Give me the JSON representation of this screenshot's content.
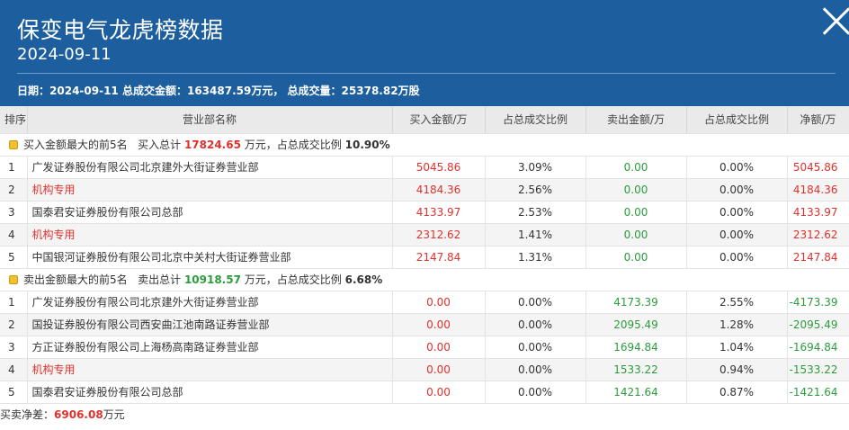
{
  "header": {
    "title": "保变电气龙虎榜数据",
    "date": "2024-09-11",
    "summary": {
      "date_label": "日期：",
      "date_value": "2024-09-11",
      "amount_label": "总成交金额：",
      "amount_value": "163487.59万元，",
      "volume_label": "总成交量：",
      "volume_value": "25378.82万股"
    }
  },
  "table": {
    "columns": [
      "排序",
      "营业部名称",
      "买入金额/万",
      "占总成交比例",
      "卖出金额/万",
      "占总成交比例",
      "净额/万"
    ]
  },
  "buy_group": {
    "label": "买入金额最大的前5名",
    "total_label": "买入总计",
    "total_value": "17824.65",
    "unit": "万元，",
    "ratio_label": "占总成交比例",
    "ratio_value": "10.90%",
    "rows": [
      {
        "rank": "1",
        "name": "广发证券股份有限公司北京建外大街证券营业部",
        "institution": false,
        "buy": "5045.86",
        "buy_pct": "3.09%",
        "sell": "0.00",
        "sell_pct": "0.00%",
        "net": "5045.86",
        "net_sign": "pos"
      },
      {
        "rank": "2",
        "name": "机构专用",
        "institution": true,
        "buy": "4184.36",
        "buy_pct": "2.56%",
        "sell": "0.00",
        "sell_pct": "0.00%",
        "net": "4184.36",
        "net_sign": "pos"
      },
      {
        "rank": "3",
        "name": "国泰君安证券股份有限公司总部",
        "institution": false,
        "buy": "4133.97",
        "buy_pct": "2.53%",
        "sell": "0.00",
        "sell_pct": "0.00%",
        "net": "4133.97",
        "net_sign": "pos"
      },
      {
        "rank": "4",
        "name": "机构专用",
        "institution": true,
        "buy": "2312.62",
        "buy_pct": "1.41%",
        "sell": "0.00",
        "sell_pct": "0.00%",
        "net": "2312.62",
        "net_sign": "pos"
      },
      {
        "rank": "5",
        "name": "中国银河证券股份有限公司北京中关村大街证券营业部",
        "institution": false,
        "buy": "2147.84",
        "buy_pct": "1.31%",
        "sell": "0.00",
        "sell_pct": "0.00%",
        "net": "2147.84",
        "net_sign": "pos"
      }
    ]
  },
  "sell_group": {
    "label": "卖出金额最大的前5名",
    "total_label": "卖出总计",
    "total_value": "10918.57",
    "unit": "万元，",
    "ratio_label": "占总成交比例",
    "ratio_value": "6.68%",
    "rows": [
      {
        "rank": "1",
        "name": "广发证券股份有限公司北京建外大街证券营业部",
        "institution": false,
        "buy": "0.00",
        "buy_pct": "0.00%",
        "sell": "4173.39",
        "sell_pct": "2.55%",
        "net": "-4173.39",
        "net_sign": "neg"
      },
      {
        "rank": "2",
        "name": "国投证券股份有限公司西安曲江池南路证券营业部",
        "institution": false,
        "buy": "0.00",
        "buy_pct": "0.00%",
        "sell": "2095.49",
        "sell_pct": "1.28%",
        "net": "-2095.49",
        "net_sign": "neg"
      },
      {
        "rank": "3",
        "name": "方正证券股份有限公司上海杨高南路证券营业部",
        "institution": false,
        "buy": "0.00",
        "buy_pct": "0.00%",
        "sell": "1694.84",
        "sell_pct": "1.04%",
        "net": "-1694.84",
        "net_sign": "neg"
      },
      {
        "rank": "4",
        "name": "机构专用",
        "institution": true,
        "buy": "0.00",
        "buy_pct": "0.00%",
        "sell": "1533.22",
        "sell_pct": "0.94%",
        "net": "-1533.22",
        "net_sign": "neg"
      },
      {
        "rank": "5",
        "name": "国泰君安证券股份有限公司总部",
        "institution": false,
        "buy": "0.00",
        "buy_pct": "0.00%",
        "sell": "1421.64",
        "sell_pct": "0.87%",
        "net": "-1421.64",
        "net_sign": "neg"
      }
    ]
  },
  "footer": {
    "label": "买卖净差：",
    "value": "6906.08",
    "unit": "万元"
  },
  "colors": {
    "header_bg": "#1d5f9e",
    "red": "#e0312c",
    "green": "#2c9c3c"
  },
  "icons": {
    "close": "close-icon",
    "group": "money-bag-icon"
  }
}
